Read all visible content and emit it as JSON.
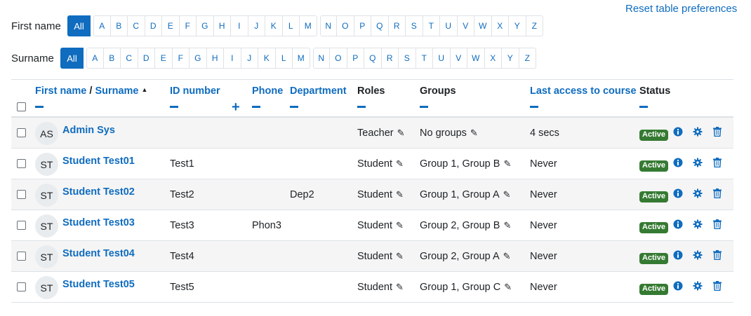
{
  "reset_link": "Reset table preferences",
  "initials": {
    "first_label": "First name",
    "surname_label": "Surname",
    "all": "All",
    "letters_a": [
      "A",
      "B",
      "C",
      "D",
      "E",
      "F",
      "G",
      "H",
      "I",
      "J",
      "K",
      "L",
      "M"
    ],
    "letters_b": [
      "N",
      "O",
      "P",
      "Q",
      "R",
      "S",
      "T",
      "U",
      "V",
      "W",
      "X",
      "Y",
      "Z"
    ]
  },
  "headers": {
    "firstname": "First name",
    "slash": " / ",
    "surname": "Surname",
    "idnumber": "ID number",
    "phone": "Phone",
    "department": "Department",
    "roles": "Roles",
    "groups": "Groups",
    "lastaccess": "Last access to course",
    "status": "Status"
  },
  "rows": [
    {
      "initials": "AS",
      "name": "Admin Sys",
      "idnumber": "",
      "phone": "",
      "department": "",
      "role": "Teacher",
      "groups": "No groups",
      "lastaccess": "4 secs",
      "status": "Active"
    },
    {
      "initials": "ST",
      "name": "Student Test01",
      "idnumber": "Test1",
      "phone": "",
      "department": "",
      "role": "Student",
      "groups": "Group 1, Group B",
      "lastaccess": "Never",
      "status": "Active"
    },
    {
      "initials": "ST",
      "name": "Student Test02",
      "idnumber": "Test2",
      "phone": "",
      "department": "Dep2",
      "role": "Student",
      "groups": "Group 1, Group A",
      "lastaccess": "Never",
      "status": "Active"
    },
    {
      "initials": "ST",
      "name": "Student Test03",
      "idnumber": "Test3",
      "phone": "Phon3",
      "department": "",
      "role": "Student",
      "groups": "Group 2, Group B",
      "lastaccess": "Never",
      "status": "Active"
    },
    {
      "initials": "ST",
      "name": "Student Test04",
      "idnumber": "Test4",
      "phone": "",
      "department": "",
      "role": "Student",
      "groups": "Group 2, Group A",
      "lastaccess": "Never",
      "status": "Active"
    },
    {
      "initials": "ST",
      "name": "Student Test05",
      "idnumber": "Test5",
      "phone": "",
      "department": "",
      "role": "Student",
      "groups": "Group 1, Group C",
      "lastaccess": "Never",
      "status": "Active"
    }
  ],
  "colors": {
    "link": "#0f6cbf",
    "badge": "#357a32",
    "stripe": "#f5f5f5"
  },
  "icons": {
    "edit": "pencil-icon",
    "info": "info-icon",
    "settings": "gear-icon",
    "delete": "trash-icon",
    "sort": "sort-asc-icon",
    "expand": "plus-icon",
    "collapse": "minus-icon"
  }
}
